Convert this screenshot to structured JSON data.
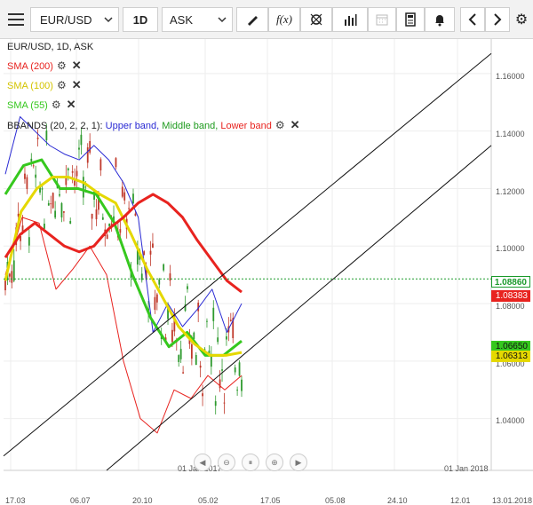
{
  "toolbar": {
    "symbol": "EUR/USD",
    "timeframe": "1D",
    "price_type": "ASK",
    "fx_label": "f(x)",
    "icons": [
      "menu-icon",
      "chevron-down-icon",
      "pencil-icon",
      "function-icon",
      "crosshair-icon",
      "bar-chart-icon",
      "calendar-icon",
      "calculator-icon",
      "alert-bell-icon",
      "chevron-left-icon",
      "chevron-right-icon",
      "gear-icon"
    ]
  },
  "legend": {
    "header": "EUR/USD, 1D, ASK",
    "sma200": "SMA (200)",
    "sma100": "SMA (100)",
    "sma55": "SMA (55)",
    "bbands_prefix": "BBANDS (20, 2, 2, 1):",
    "bb_upper": "Upper band,",
    "bb_middle": "Middle band,",
    "bb_lower": "Lower band"
  },
  "colors": {
    "sma200": "#e8231f",
    "sma100": "#e5d800",
    "sma55": "#36c81e",
    "bb_upper": "#2a2ad4",
    "bb_middle": "#1d9a1d",
    "bb_lower": "#e8231f",
    "last_price": "#1a9a2a"
  },
  "chart_data": {
    "type": "line",
    "y_axis_labels": [
      "1.16000",
      "1.14000",
      "1.12000",
      "1.10000",
      "1.08000",
      "1.06000",
      "1.04000"
    ],
    "ylim": [
      1.022,
      1.172
    ],
    "x_axis_labels": [
      "17.03",
      "06.07",
      "20.10",
      "05.02",
      "17.05",
      "05.08",
      "24.10",
      "12.01",
      "13.01.2018"
    ],
    "annotations": [
      "01 Jan 2017",
      "01 Jan 2018"
    ],
    "price_tags": [
      {
        "label": "1.08860",
        "value": 1.0886,
        "style": "last"
      },
      {
        "label": "1.08383",
        "value": 1.0838,
        "style": "sma200"
      },
      {
        "label": "1.06650",
        "value": 1.0665,
        "style": "sma55"
      },
      {
        "label": "1.06313",
        "value": 1.0631,
        "style": "sma100"
      }
    ],
    "series": [
      {
        "name": "SMA (200)",
        "values": [
          1.096,
          1.104,
          1.108,
          1.104,
          1.1,
          1.098,
          1.1,
          1.106,
          1.11,
          1.115,
          1.118,
          1.115,
          1.11,
          1.102,
          1.095,
          1.088,
          1.084
        ]
      },
      {
        "name": "SMA (100)",
        "values": [
          1.088,
          1.112,
          1.12,
          1.124,
          1.124,
          1.122,
          1.118,
          1.115,
          1.104,
          1.092,
          1.082,
          1.072,
          1.066,
          1.062,
          1.062,
          1.063
        ]
      },
      {
        "name": "SMA (55)",
        "values": [
          1.118,
          1.128,
          1.13,
          1.12,
          1.12,
          1.118,
          1.108,
          1.09,
          1.075,
          1.065,
          1.07,
          1.062,
          1.062,
          1.067
        ]
      },
      {
        "name": "Upper band",
        "values": [
          1.125,
          1.145,
          1.14,
          1.135,
          1.132,
          1.13,
          1.135,
          1.13,
          1.122,
          1.11,
          1.07,
          1.08,
          1.072,
          1.078,
          1.085,
          1.07,
          1.08
        ]
      },
      {
        "name": "Lower band",
        "values": [
          1.09,
          1.11,
          1.108,
          1.085,
          1.092,
          1.1,
          1.09,
          1.06,
          1.04,
          1.035,
          1.05,
          1.047,
          1.055,
          1.05,
          1.055
        ]
      }
    ]
  }
}
